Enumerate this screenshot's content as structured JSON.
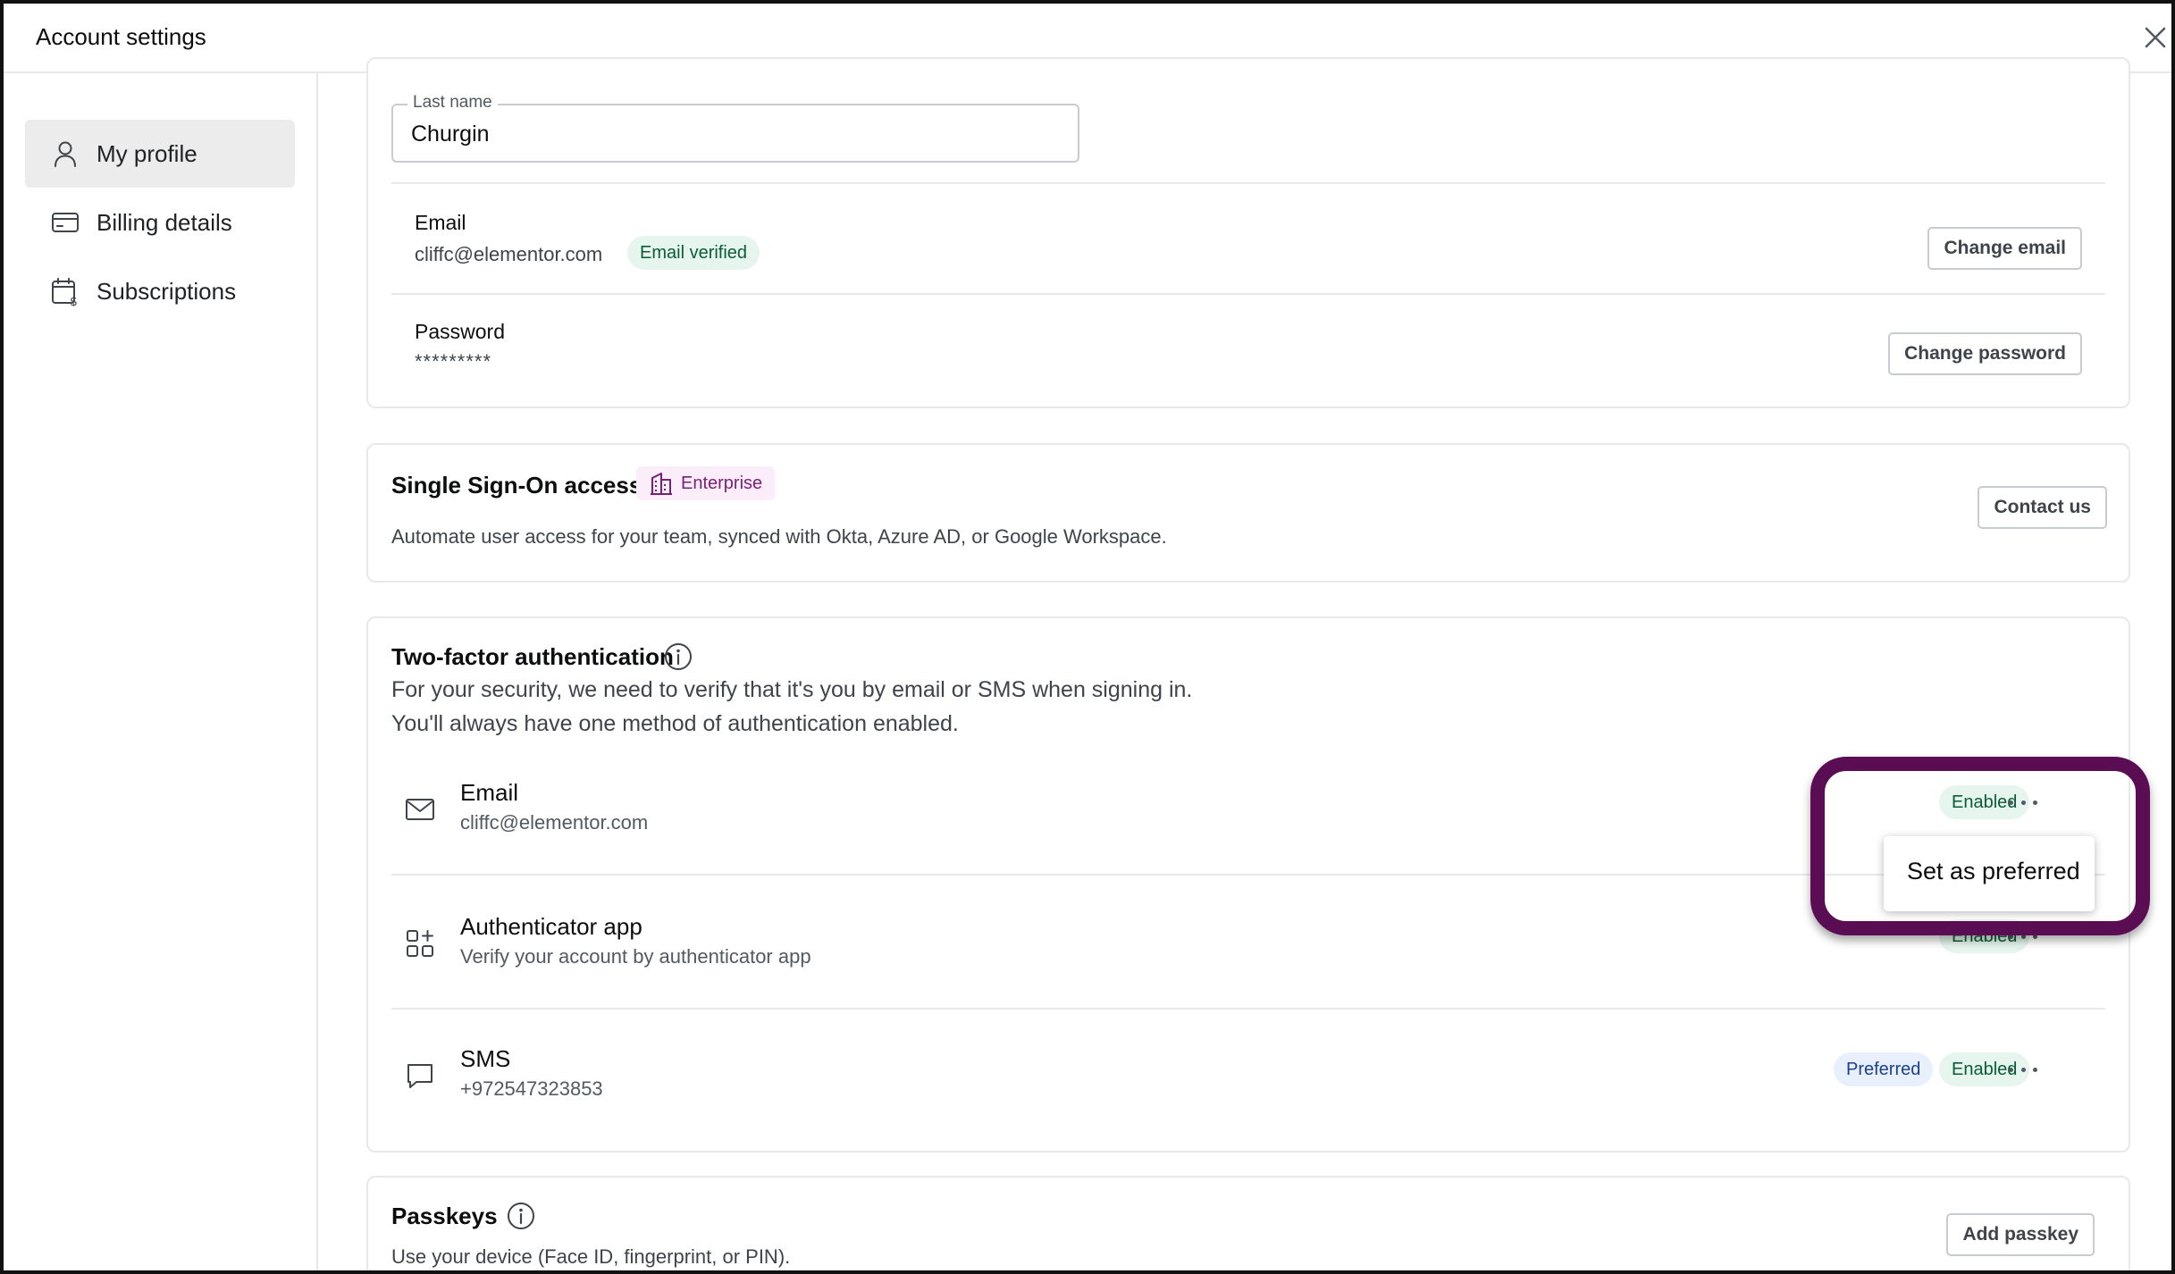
{
  "header": {
    "title": "Account settings"
  },
  "sidebar": {
    "items": [
      {
        "label": "My profile",
        "icon": "user-icon",
        "active": true
      },
      {
        "label": "Billing details",
        "icon": "credit-card-icon",
        "active": false
      },
      {
        "label": "Subscriptions",
        "icon": "calendar-dollar-icon",
        "active": false
      }
    ]
  },
  "profile": {
    "last_name_label": "Last name",
    "last_name_value": "Churgin",
    "email_label": "Email",
    "email_value": "cliffc@elementor.com",
    "email_badge": "Email verified",
    "change_email": "Change email",
    "password_label": "Password",
    "password_value": "*********",
    "change_password": "Change password"
  },
  "sso": {
    "title": "Single Sign-On access",
    "badge": "Enterprise",
    "description": "Automate user access for your team, synced with Okta, Azure AD, or Google Workspace.",
    "button": "Contact us"
  },
  "twofa": {
    "title": "Two-factor authentication",
    "line1": "For your security, we need to verify that it's you by email or SMS when signing in.",
    "line2": "You'll always have one method of authentication enabled.",
    "methods": [
      {
        "name": "Email",
        "sub": "cliffc@elementor.com",
        "status": "Enabled",
        "icon": "mail-icon"
      },
      {
        "name": "Authenticator app",
        "sub": "Verify your account by authenticator app",
        "status": "Enabled",
        "icon": "apps-icon"
      },
      {
        "name": "SMS",
        "sub": "+972547323853",
        "status": "Enabled",
        "preferred": "Preferred",
        "icon": "message-icon"
      }
    ],
    "menu_item": "Set as preferred"
  },
  "passkeys": {
    "title": "Passkeys",
    "description": "Use your device (Face ID, fingerprint, or PIN).",
    "button": "Add passkey"
  },
  "colors": {
    "highlight": "#5a0d52",
    "enabled_bg": "#e6f5ee",
    "preferred_bg": "#e8f0fd",
    "enterprise": "#7b1d7b"
  }
}
